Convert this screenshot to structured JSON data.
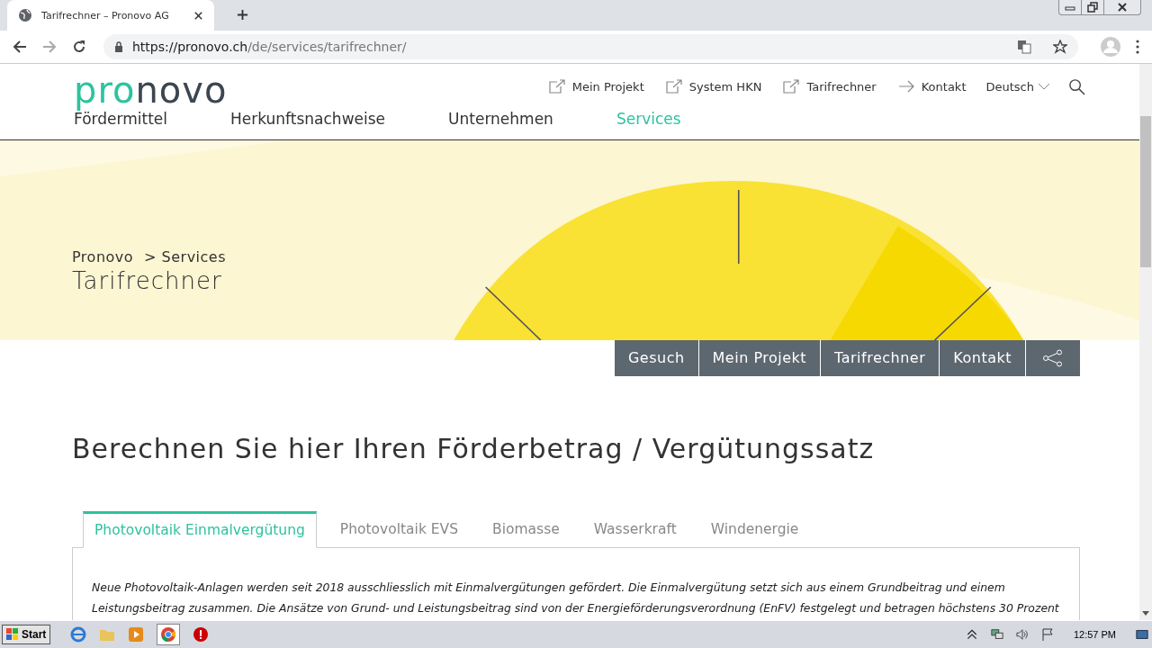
{
  "browser": {
    "tab_title": "Tarifrechner – Pronovo AG",
    "url_host": "https://pronovo.ch",
    "url_path": "/de/services/tarifrechner/"
  },
  "header": {
    "logo_accent": "pro",
    "logo_rest": "novo",
    "top_links": [
      {
        "label": "Mein Projekt",
        "kind": "external"
      },
      {
        "label": "System HKN",
        "kind": "external"
      },
      {
        "label": "Tarifrechner",
        "kind": "external"
      },
      {
        "label": "Kontakt",
        "kind": "arrow"
      }
    ],
    "language": "Deutsch",
    "nav": [
      {
        "label": "Fördermittel",
        "selected": false
      },
      {
        "label": "Herkunftsnachweise",
        "selected": false
      },
      {
        "label": "Unternehmen",
        "selected": false
      },
      {
        "label": "Services",
        "selected": true
      }
    ]
  },
  "hero": {
    "breadcrumb": [
      "Pronovo",
      "> Services"
    ],
    "title": "Tarifrechner"
  },
  "action_bar": [
    "Gesuch",
    "Mein Projekt",
    "Tarifrechner",
    "Kontakt"
  ],
  "heading": "Berechnen Sie hier Ihren Förderbetrag / Vergütungssatz",
  "tabs": [
    {
      "label": "Photovoltaik Einmalvergütung",
      "selected": true
    },
    {
      "label": "Photovoltaik EVS",
      "selected": false
    },
    {
      "label": "Biomasse",
      "selected": false
    },
    {
      "label": "Wasserkraft",
      "selected": false
    },
    {
      "label": "Windenergie",
      "selected": false
    }
  ],
  "intro_lines": [
    "Neue Photovoltaik-Anlagen werden seit 2018 ausschliesslich mit Einmalvergütungen gefördert. Die Einmalvergütung setzt sich aus einem Grundbeitrag und einem",
    "Leistungsbeitrag zusammen. Die Ansätze von Grund- und Leistungsbeitrag sind von der Energieförderungsverordnung (EnFV) festgelegt und betragen höchstens 30 Prozent"
  ],
  "taskbar": {
    "start": "Start",
    "clock": "12:57 PM"
  }
}
